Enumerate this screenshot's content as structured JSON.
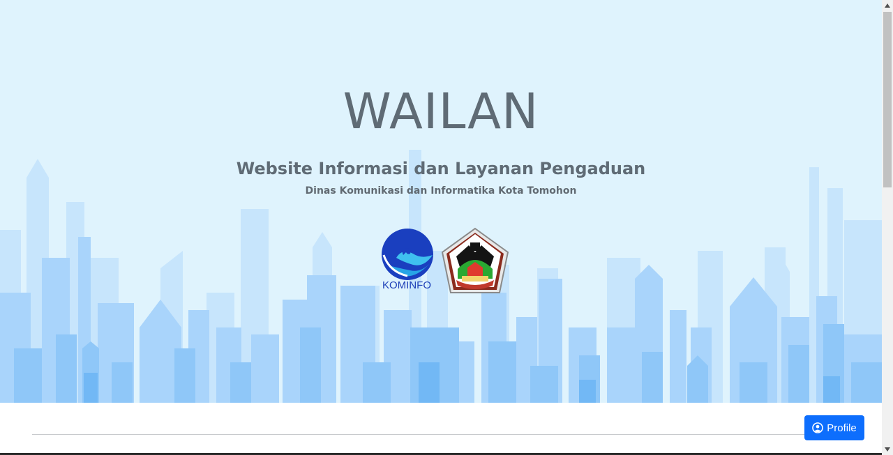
{
  "hero": {
    "title": "WAILAN",
    "subtitle": "Website Informasi dan Layanan Pengaduan",
    "agency": "Dinas Komunikasi dan Informatika Kota Tomohon"
  },
  "logos": {
    "kominfo_text": "KOMINFO",
    "kominfo_icon": "kominfo-logo-icon",
    "tomohon_icon": "tomohon-crest-icon"
  },
  "actions": {
    "profile_label": "Profile",
    "profile_icon": "user-circle-icon"
  },
  "colors": {
    "sky": "#dff3fd",
    "building_light": "#b9defb",
    "building_dark": "#6fb7f6",
    "primary_button": "#0d6efd",
    "text": "#5f6b75"
  }
}
